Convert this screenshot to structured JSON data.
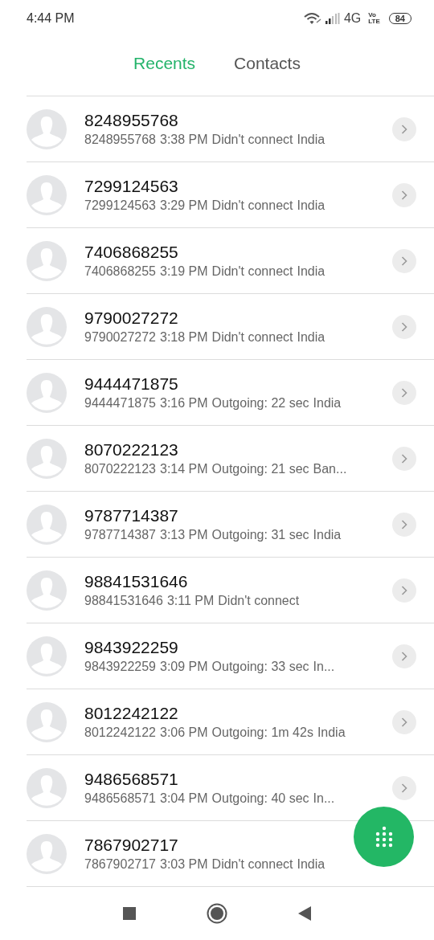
{
  "status_bar": {
    "time": "4:44 PM",
    "network": "4G",
    "volte": [
      "Vo",
      "LTE"
    ],
    "battery": "84"
  },
  "tabs": [
    {
      "label": "Recents",
      "selected": true
    },
    {
      "label": "Contacts",
      "selected": false
    }
  ],
  "calls": [
    {
      "name": "8248955768",
      "number": "8248955768",
      "time": "3:38 PM",
      "status": "Didn't connect",
      "location": "India",
      "details_visible": true
    },
    {
      "name": "7299124563",
      "number": "7299124563",
      "time": "3:29 PM",
      "status": "Didn't connect",
      "location": "India",
      "details_visible": true
    },
    {
      "name": "7406868255",
      "number": "7406868255",
      "time": "3:19 PM",
      "status": "Didn't connect",
      "location": "India",
      "details_visible": true
    },
    {
      "name": "9790027272",
      "number": "9790027272",
      "time": "3:18 PM",
      "status": "Didn't connect",
      "location": "India",
      "details_visible": true
    },
    {
      "name": "9444471875",
      "number": "9444471875",
      "time": "3:16 PM",
      "status": "Outgoing: 22 sec",
      "location": "India",
      "details_visible": true
    },
    {
      "name": "8070222123",
      "number": "8070222123",
      "time": "3:14 PM",
      "status": "Outgoing: 21 sec",
      "location": "Ban...",
      "details_visible": true
    },
    {
      "name": "9787714387",
      "number": "9787714387",
      "time": "3:13 PM",
      "status": "Outgoing: 31 sec",
      "location": "India",
      "details_visible": true
    },
    {
      "name": "98841531646",
      "number": "98841531646",
      "time": "3:11 PM",
      "status": "Didn't connect",
      "details_visible": true
    },
    {
      "name": "9843922259",
      "number": "9843922259",
      "time": "3:09 PM",
      "status": "Outgoing: 33 sec",
      "location": "In...",
      "details_visible": true
    },
    {
      "name": "8012242122",
      "number": "8012242122",
      "time": "3:06 PM",
      "status": "Outgoing: 1m 42s",
      "location": "India",
      "details_visible": true
    },
    {
      "name": "9486568571",
      "number": "9486568571",
      "time": "3:04 PM",
      "status": "Outgoing: 40 sec",
      "location": "In...",
      "details_visible": true
    },
    {
      "name": "7867902717",
      "number": "7867902717",
      "time": "3:03 PM",
      "status": "Didn't connect",
      "location": "India",
      "details_visible": false
    }
  ]
}
